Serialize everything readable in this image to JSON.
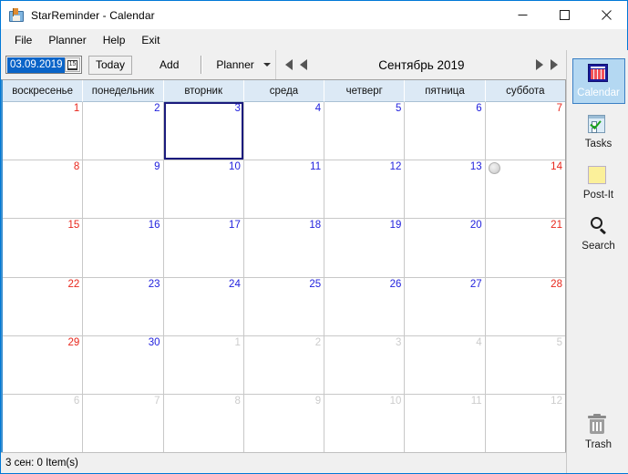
{
  "window": {
    "title": "StarReminder - Calendar",
    "icon": "app-icon",
    "controls": {
      "minimize": "minimize-icon",
      "maximize": "maximize-icon",
      "close": "close-icon"
    }
  },
  "menubar": {
    "items": [
      {
        "label": "File"
      },
      {
        "label": "Planner"
      },
      {
        "label": "Help"
      },
      {
        "label": "Exit"
      }
    ]
  },
  "toolbar": {
    "date_value": "03.09.2019",
    "date_picker_icon": "calendar-picker-icon",
    "today_label": "Today",
    "add_label": "Add",
    "planner_label": "Planner",
    "planner_caret_icon": "chevron-down-icon"
  },
  "navigation": {
    "prev_year_icon": "double-left-arrow-icon",
    "prev_month_icon": "left-arrow-icon",
    "title": "Сентябрь 2019",
    "next_month_icon": "right-arrow-icon",
    "next_year_icon": "double-right-arrow-icon"
  },
  "calendar": {
    "day_headers": [
      "воскресенье",
      "понедельник",
      "вторник",
      "среда",
      "четверг",
      "пятница",
      "суббота"
    ],
    "selected_day": 3,
    "weeks": [
      [
        {
          "num": "1",
          "type": "weekend"
        },
        {
          "num": "2",
          "type": "weekday"
        },
        {
          "num": "3",
          "type": "weekday",
          "selected": true
        },
        {
          "num": "4",
          "type": "weekday"
        },
        {
          "num": "5",
          "type": "weekday"
        },
        {
          "num": "6",
          "type": "weekday"
        },
        {
          "num": "7",
          "type": "weekend"
        }
      ],
      [
        {
          "num": "8",
          "type": "weekend"
        },
        {
          "num": "9",
          "type": "weekday"
        },
        {
          "num": "10",
          "type": "weekday"
        },
        {
          "num": "11",
          "type": "weekday"
        },
        {
          "num": "12",
          "type": "weekday"
        },
        {
          "num": "13",
          "type": "weekday"
        },
        {
          "num": "14",
          "type": "weekend",
          "moon": "moon-phase-icon"
        }
      ],
      [
        {
          "num": "15",
          "type": "weekend"
        },
        {
          "num": "16",
          "type": "weekday"
        },
        {
          "num": "17",
          "type": "weekday"
        },
        {
          "num": "18",
          "type": "weekday"
        },
        {
          "num": "19",
          "type": "weekday"
        },
        {
          "num": "20",
          "type": "weekday"
        },
        {
          "num": "21",
          "type": "weekend"
        }
      ],
      [
        {
          "num": "22",
          "type": "weekend"
        },
        {
          "num": "23",
          "type": "weekday"
        },
        {
          "num": "24",
          "type": "weekday"
        },
        {
          "num": "25",
          "type": "weekday"
        },
        {
          "num": "26",
          "type": "weekday"
        },
        {
          "num": "27",
          "type": "weekday"
        },
        {
          "num": "28",
          "type": "weekend"
        }
      ],
      [
        {
          "num": "29",
          "type": "weekend"
        },
        {
          "num": "30",
          "type": "weekday"
        },
        {
          "num": "1",
          "type": "other"
        },
        {
          "num": "2",
          "type": "other"
        },
        {
          "num": "3",
          "type": "other"
        },
        {
          "num": "4",
          "type": "other"
        },
        {
          "num": "5",
          "type": "other"
        }
      ],
      [
        {
          "num": "6",
          "type": "other"
        },
        {
          "num": "7",
          "type": "other"
        },
        {
          "num": "8",
          "type": "other"
        },
        {
          "num": "9",
          "type": "other"
        },
        {
          "num": "10",
          "type": "other"
        },
        {
          "num": "11",
          "type": "other"
        },
        {
          "num": "12",
          "type": "other"
        }
      ]
    ]
  },
  "sidebar": {
    "items": [
      {
        "label": "Calendar",
        "icon": "calendar-icon",
        "active": true
      },
      {
        "label": "Tasks",
        "icon": "tasks-icon",
        "active": false
      },
      {
        "label": "Post-It",
        "icon": "postit-icon",
        "active": false
      },
      {
        "label": "Search",
        "icon": "search-icon",
        "active": false
      }
    ],
    "trash": {
      "label": "Trash",
      "icon": "trash-icon"
    }
  },
  "statusbar": {
    "text": "3 сен: 0 Item(s)"
  },
  "colors": {
    "accent": "#0078d7",
    "weekend": "#e8271c",
    "weekday": "#2222dd",
    "other_month": "#cccccc",
    "selection_border": "#1b1b7d",
    "header_bg": "#dce9f5",
    "sidebar_active_bg": "#b4d8f2"
  }
}
